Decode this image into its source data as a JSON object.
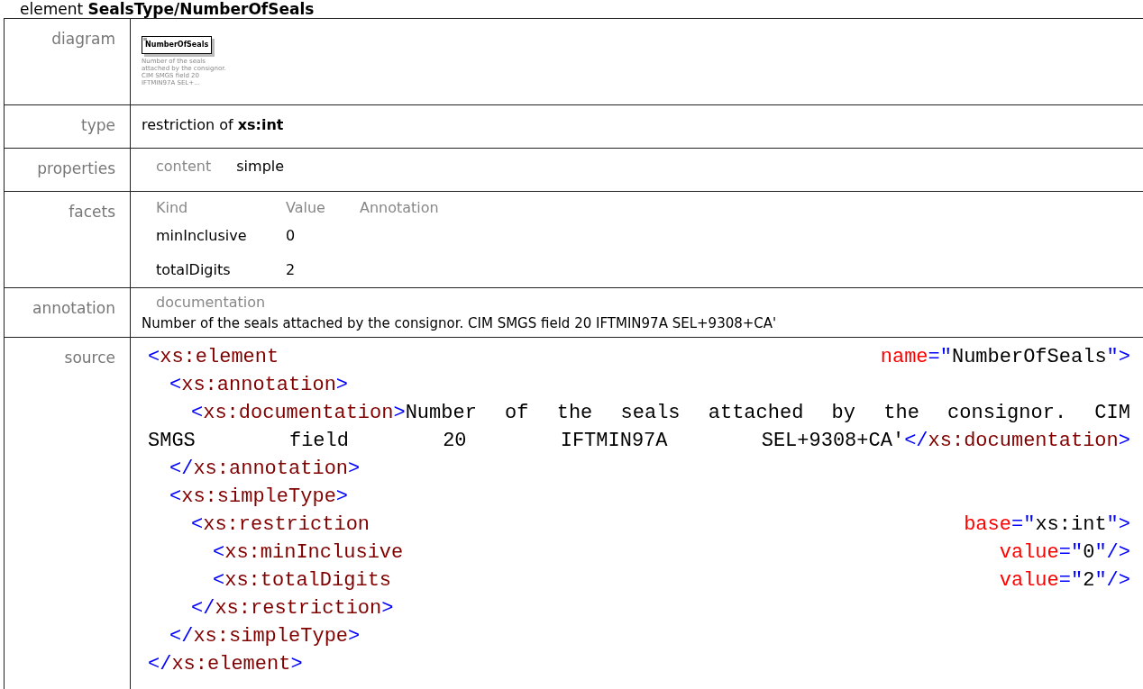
{
  "title": {
    "prefix": "element",
    "name": "SealsType/NumberOfSeals"
  },
  "diagram": {
    "label": "diagram",
    "element": "NumberOfSeals",
    "note": "Number of the seals attached by the consignor. CIM SMGS field 20 IFTMIN97A SEL+..."
  },
  "type": {
    "label": "type",
    "prefix": "restriction of",
    "base": "xs:int"
  },
  "properties": {
    "label": "properties",
    "items": [
      {
        "name": "content",
        "value": "simple"
      }
    ]
  },
  "facets": {
    "label": "facets",
    "columns": [
      "Kind",
      "Value",
      "Annotation"
    ],
    "rows": [
      {
        "kind": "minInclusive",
        "value": "0"
      },
      {
        "kind": "totalDigits",
        "value": "2"
      }
    ]
  },
  "annotation": {
    "label": "annotation",
    "heading": "documentation",
    "text": "Number of the seals attached by the consignor. CIM SMGS field 20 IFTMIN97A SEL+9308+CA'"
  },
  "source": {
    "label": "source",
    "lines": [
      {
        "groups": [
          [
            {
              "kind": "punct",
              "text": "<"
            },
            {
              "kind": "tag",
              "text": "xs:element"
            }
          ],
          [
            {
              "kind": "attr",
              "text": "name"
            },
            {
              "kind": "punct",
              "text": "=\""
            },
            {
              "kind": "value",
              "text": "NumberOfSeals"
            },
            {
              "kind": "punct",
              "text": "\">"
            }
          ]
        ],
        "children": [
          {
            "groups": [
              [
                {
                  "kind": "punct",
                  "text": "<"
                },
                {
                  "kind": "tag",
                  "text": "xs:annotation"
                },
                {
                  "kind": "punct",
                  "text": ">"
                }
              ]
            ],
            "children": [
              {
                "groups": [
                  [
                    {
                      "kind": "punct",
                      "text": "<"
                    },
                    {
                      "kind": "tag",
                      "text": "xs:documentation"
                    },
                    {
                      "kind": "punct",
                      "text": ">"
                    },
                    {
                      "kind": "value",
                      "text": "Number"
                    }
                  ],
                  [
                    {
                      "kind": "value",
                      "text": "of"
                    }
                  ],
                  [
                    {
                      "kind": "value",
                      "text": "the"
                    }
                  ],
                  [
                    {
                      "kind": "value",
                      "text": "seals"
                    }
                  ],
                  [
                    {
                      "kind": "value",
                      "text": "attached"
                    }
                  ],
                  [
                    {
                      "kind": "value",
                      "text": "by"
                    }
                  ],
                  [
                    {
                      "kind": "value",
                      "text": "the"
                    }
                  ],
                  [
                    {
                      "kind": "value",
                      "text": "consignor."
                    }
                  ],
                  [
                    {
                      "kind": "value",
                      "text": "CIM"
                    }
                  ]
                ]
              },
              {
                "wrap": true,
                "groups": [
                  [
                    {
                      "kind": "value",
                      "text": "SMGS"
                    }
                  ],
                  [
                    {
                      "kind": "value",
                      "text": "field"
                    }
                  ],
                  [
                    {
                      "kind": "value",
                      "text": "20"
                    }
                  ],
                  [
                    {
                      "kind": "value",
                      "text": "IFTMIN97A"
                    }
                  ],
                  [
                    {
                      "kind": "value",
                      "text": "SEL+9308+CA'"
                    },
                    {
                      "kind": "punct",
                      "text": "</"
                    },
                    {
                      "kind": "tag",
                      "text": "xs:documentation"
                    },
                    {
                      "kind": "punct",
                      "text": ">"
                    }
                  ]
                ]
              }
            ]
          },
          {
            "groups": [
              [
                {
                  "kind": "punct",
                  "text": "</"
                },
                {
                  "kind": "tag",
                  "text": "xs:annotation"
                },
                {
                  "kind": "punct",
                  "text": ">"
                }
              ]
            ]
          },
          {
            "groups": [
              [
                {
                  "kind": "punct",
                  "text": "<"
                },
                {
                  "kind": "tag",
                  "text": "xs:simpleType"
                },
                {
                  "kind": "punct",
                  "text": ">"
                }
              ]
            ],
            "children": [
              {
                "groups": [
                  [
                    {
                      "kind": "punct",
                      "text": "<"
                    },
                    {
                      "kind": "tag",
                      "text": "xs:restriction"
                    }
                  ],
                  [
                    {
                      "kind": "attr",
                      "text": "base"
                    },
                    {
                      "kind": "punct",
                      "text": "=\""
                    },
                    {
                      "kind": "value",
                      "text": "xs:int"
                    },
                    {
                      "kind": "punct",
                      "text": "\">"
                    }
                  ]
                ],
                "children": [
                  {
                    "groups": [
                      [
                        {
                          "kind": "punct",
                          "text": "<"
                        },
                        {
                          "kind": "tag",
                          "text": "xs:minInclusive"
                        }
                      ],
                      [
                        {
                          "kind": "attr",
                          "text": "value"
                        },
                        {
                          "kind": "punct",
                          "text": "=\""
                        },
                        {
                          "kind": "value",
                          "text": "0"
                        },
                        {
                          "kind": "punct",
                          "text": "\"/>"
                        }
                      ]
                    ]
                  },
                  {
                    "groups": [
                      [
                        {
                          "kind": "punct",
                          "text": "<"
                        },
                        {
                          "kind": "tag",
                          "text": "xs:totalDigits"
                        }
                      ],
                      [
                        {
                          "kind": "attr",
                          "text": "value"
                        },
                        {
                          "kind": "punct",
                          "text": "=\""
                        },
                        {
                          "kind": "value",
                          "text": "2"
                        },
                        {
                          "kind": "punct",
                          "text": "\"/>"
                        }
                      ]
                    ]
                  }
                ]
              },
              {
                "groups": [
                  [
                    {
                      "kind": "punct",
                      "text": "</"
                    },
                    {
                      "kind": "tag",
                      "text": "xs:restriction"
                    },
                    {
                      "kind": "punct",
                      "text": ">"
                    }
                  ]
                ]
              }
            ]
          },
          {
            "groups": [
              [
                {
                  "kind": "punct",
                  "text": "</"
                },
                {
                  "kind": "tag",
                  "text": "xs:simpleType"
                },
                {
                  "kind": "punct",
                  "text": ">"
                }
              ]
            ]
          }
        ]
      },
      {
        "groups": [
          [
            {
              "kind": "punct",
              "text": "</"
            },
            {
              "kind": "tag",
              "text": "xs:element"
            },
            {
              "kind": "punct",
              "text": ">"
            }
          ]
        ]
      }
    ]
  }
}
